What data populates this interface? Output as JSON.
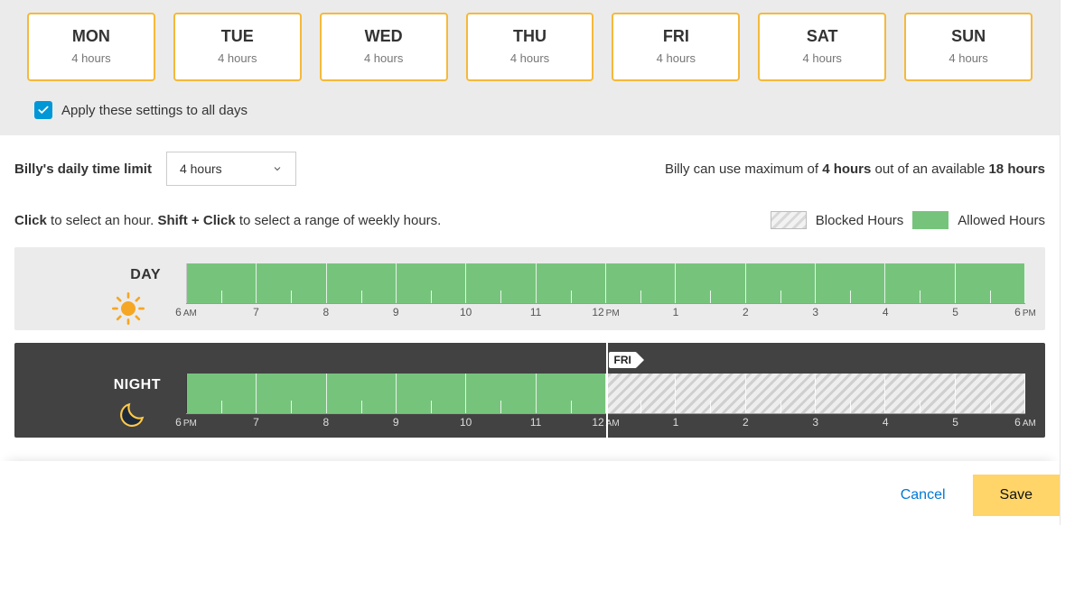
{
  "days": {
    "cards": [
      {
        "abbr": "MON",
        "duration": "4 hours"
      },
      {
        "abbr": "TUE",
        "duration": "4 hours"
      },
      {
        "abbr": "WED",
        "duration": "4 hours"
      },
      {
        "abbr": "THU",
        "duration": "4 hours"
      },
      {
        "abbr": "FRI",
        "duration": "4 hours"
      },
      {
        "abbr": "SAT",
        "duration": "4 hours"
      },
      {
        "abbr": "SUN",
        "duration": "4 hours"
      }
    ]
  },
  "apply_all": {
    "label": "Apply these settings to all days",
    "checked": true
  },
  "limit": {
    "title": "Billy's daily time limit",
    "selected": "4 hours",
    "summary_prefix": "Billy can use maximum of ",
    "summary_max": "4 hours",
    "summary_mid": " out of an available ",
    "summary_avail": "18 hours"
  },
  "instructions": {
    "click_strong": "Click",
    "click_rest": " to select an hour. ",
    "shift_strong": "Shift + Click",
    "shift_rest": " to select a range of weekly hours."
  },
  "legend": {
    "blocked": "Blocked Hours",
    "allowed": "Allowed Hours"
  },
  "schedule": {
    "day": {
      "label": "DAY",
      "ticks": [
        {
          "h": "6",
          "ampm": "AM"
        },
        {
          "h": "7"
        },
        {
          "h": "8"
        },
        {
          "h": "9"
        },
        {
          "h": "10"
        },
        {
          "h": "11"
        },
        {
          "h": "12",
          "ampm": "PM"
        },
        {
          "h": "1"
        },
        {
          "h": "2"
        },
        {
          "h": "3"
        },
        {
          "h": "4"
        },
        {
          "h": "5"
        },
        {
          "h": "6",
          "ampm": "PM"
        }
      ],
      "cells": [
        "allowed",
        "allowed",
        "allowed",
        "allowed",
        "allowed",
        "allowed",
        "allowed",
        "allowed",
        "allowed",
        "allowed",
        "allowed",
        "allowed"
      ]
    },
    "night": {
      "label": "NIGHT",
      "marker": "FRI",
      "ticks": [
        {
          "h": "6",
          "ampm": "PM"
        },
        {
          "h": "7"
        },
        {
          "h": "8"
        },
        {
          "h": "9"
        },
        {
          "h": "10"
        },
        {
          "h": "11"
        },
        {
          "h": "12",
          "ampm": "AM"
        },
        {
          "h": "1"
        },
        {
          "h": "2"
        },
        {
          "h": "3"
        },
        {
          "h": "4"
        },
        {
          "h": "5"
        },
        {
          "h": "6",
          "ampm": "AM"
        }
      ],
      "cells": [
        "allowed",
        "allowed",
        "allowed",
        "allowed",
        "allowed",
        "allowed",
        "blocked",
        "blocked",
        "blocked",
        "blocked",
        "blocked",
        "blocked"
      ]
    }
  },
  "footer": {
    "cancel": "Cancel",
    "save": "Save"
  },
  "colors": {
    "accent_orange": "#f5b93a",
    "allowed_green": "#76c47c",
    "link_blue": "#0078d4",
    "checkbox_blue": "#0097d7",
    "save_yellow": "#ffd56a"
  }
}
